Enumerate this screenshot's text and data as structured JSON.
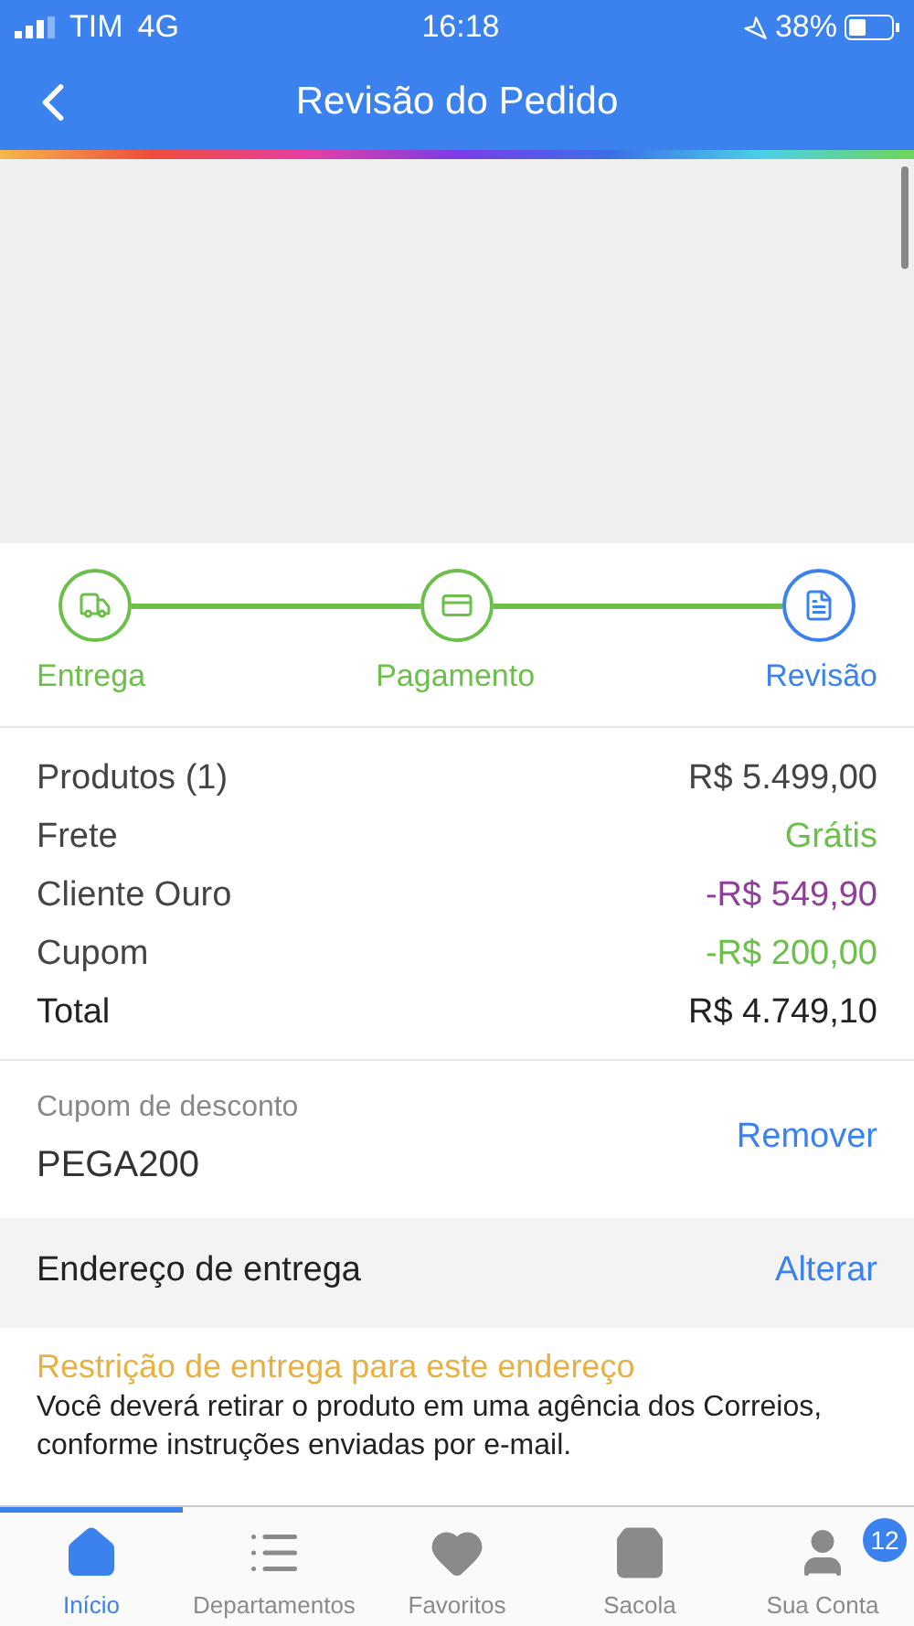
{
  "status_bar": {
    "carrier": "TIM",
    "network": "4G",
    "time": "16:18",
    "battery": "38%"
  },
  "header": {
    "title": "Revisão do Pedido"
  },
  "steps": [
    {
      "label": "Entrega",
      "done": true,
      "selected": false
    },
    {
      "label": "Pagamento",
      "done": true,
      "selected": false
    },
    {
      "label": "Revisão",
      "done": false,
      "selected": true
    }
  ],
  "summary": [
    {
      "label": "Produtos (1)",
      "value": "R$ 5.499,00",
      "color": "#444444"
    },
    {
      "label": "Frete",
      "value": "Grátis",
      "color": "#6cbf4a"
    },
    {
      "label": "Cliente Ouro",
      "value": "-R$ 549,90",
      "color": "#8e3f96"
    },
    {
      "label": "Cupom",
      "value": "-R$ 200,00",
      "color": "#6cbf4a"
    },
    {
      "label": "Total",
      "value": "R$ 4.749,10",
      "color": "#222222"
    }
  ],
  "coupon": {
    "label": "Cupom de desconto",
    "code": "PEGA200",
    "action": "Remover"
  },
  "address": {
    "title": "Endereço de entrega",
    "action": "Alterar",
    "warning_title": "Restrição de entrega para este endereço",
    "warning_text": "Você deverá retirar o produto em uma agência dos Correios, conforme instruções enviadas por e-mail."
  },
  "tabs": [
    {
      "label": "Início",
      "selected": true
    },
    {
      "label": "Departamentos",
      "selected": false
    },
    {
      "label": "Favoritos",
      "selected": false
    },
    {
      "label": "Sacola",
      "selected": false
    },
    {
      "label": "Sua Conta",
      "selected": false,
      "badge": "12"
    }
  ]
}
